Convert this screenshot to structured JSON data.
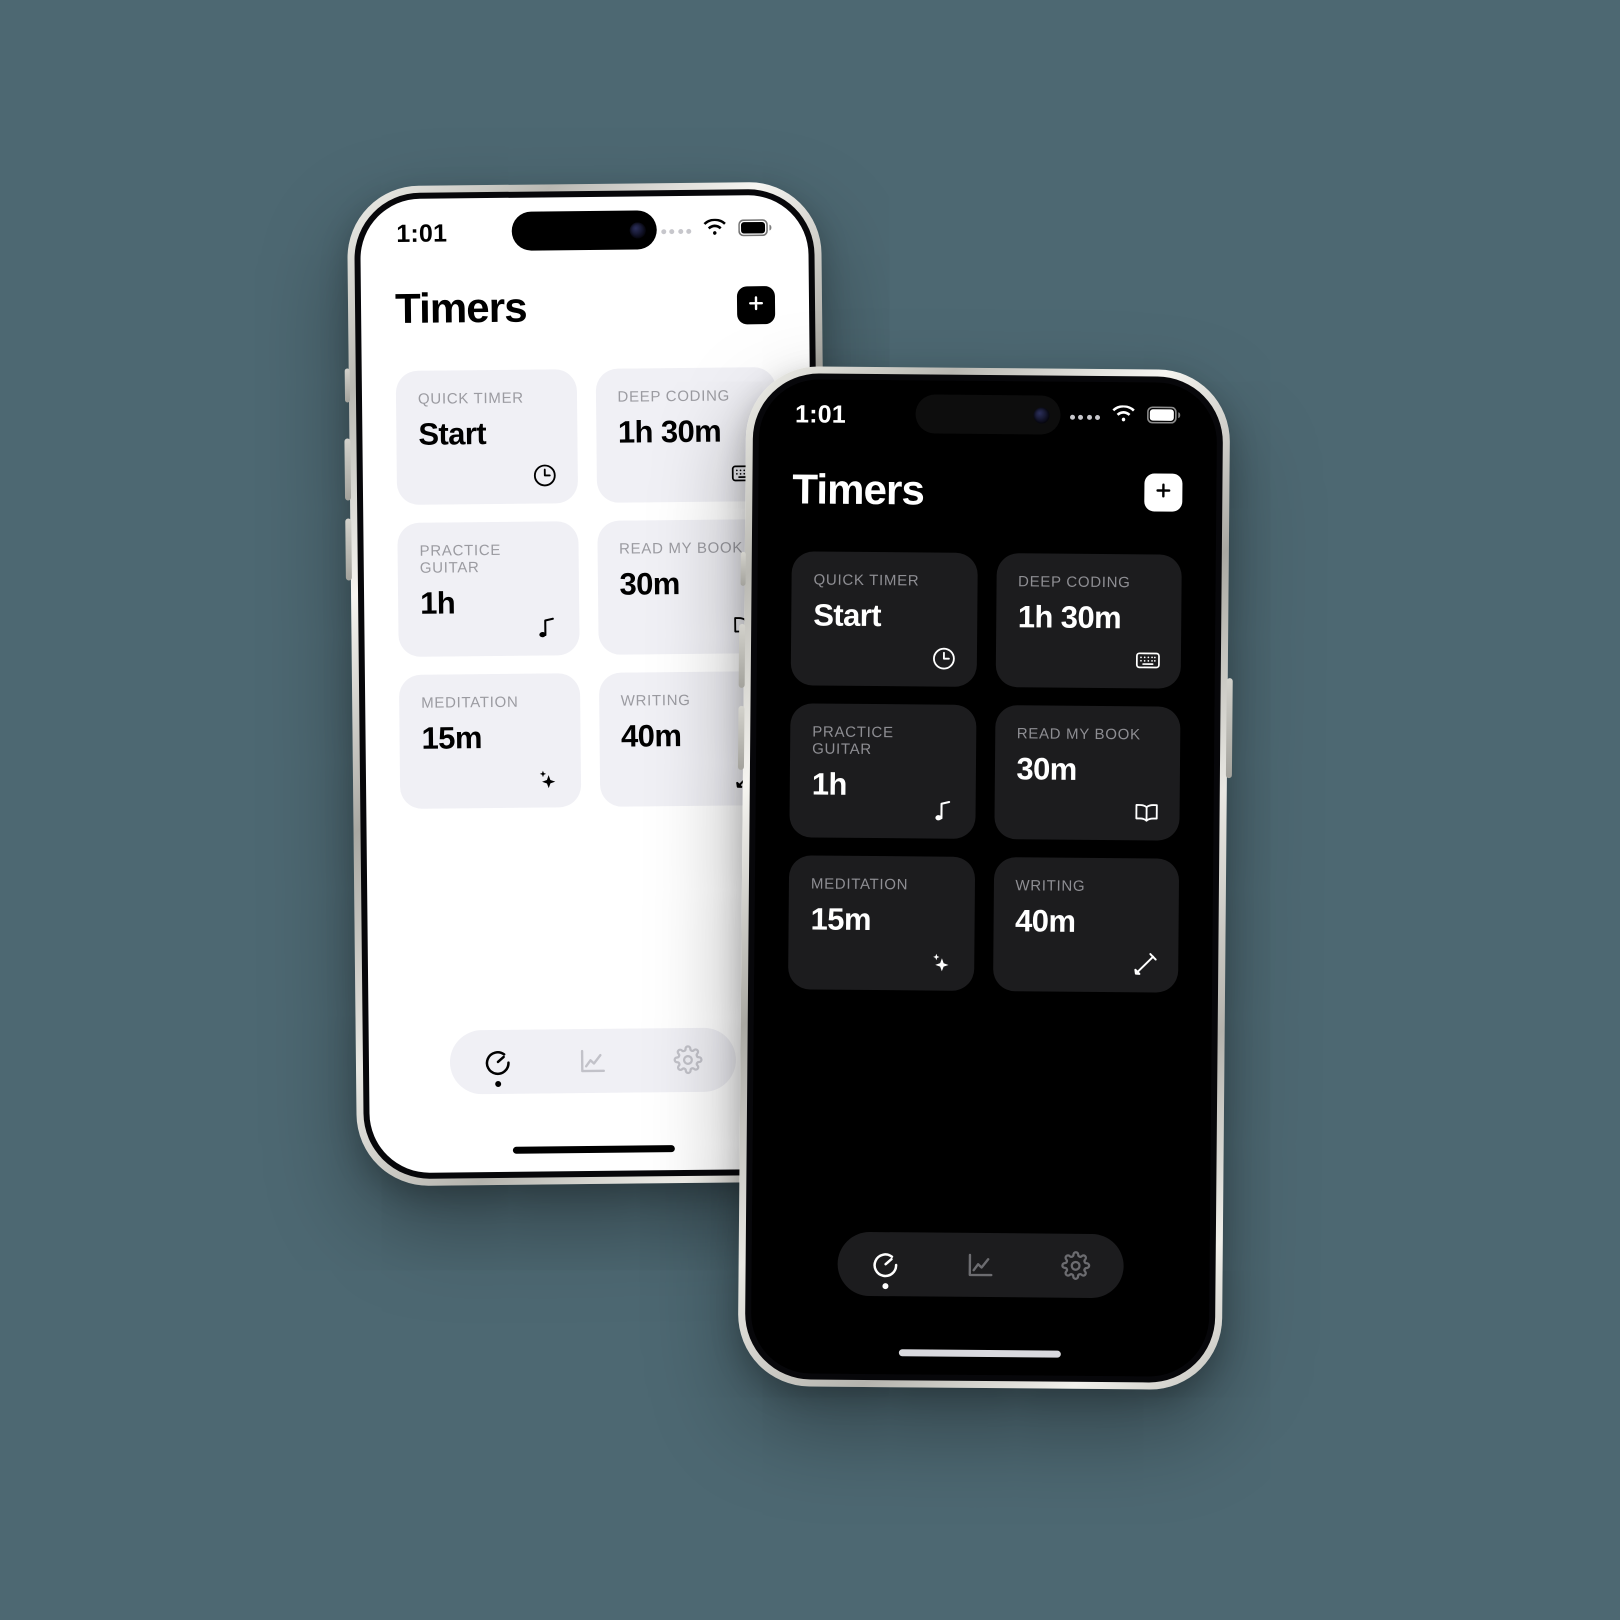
{
  "background_color": "#4d6872",
  "phones": [
    {
      "id": "light",
      "appearance": "Light",
      "status": {
        "time": "1:01",
        "cellular_icon": "cellular-dots-icon",
        "wifi_icon": "wifi-icon",
        "battery_icon": "battery-icon"
      },
      "header": {
        "title": "Timers",
        "add_label": "+",
        "add_icon": "plus-icon"
      },
      "cards": [
        {
          "label": "QUICK TIMER",
          "value": "Start",
          "icon": "clock-icon"
        },
        {
          "label": "DEEP CODING",
          "value": "1h 30m",
          "icon": "keyboard-icon"
        },
        {
          "label": "PRACTICE GUITAR",
          "value": "1h",
          "icon": "music-note-icon"
        },
        {
          "label": "READ MY BOOK",
          "value": "30m",
          "icon": "book-icon"
        },
        {
          "label": "MEDITATION",
          "value": "15m",
          "icon": "sparkles-icon"
        },
        {
          "label": "WRITING",
          "value": "40m",
          "icon": "pencil-icon"
        }
      ],
      "tabs": [
        {
          "name": "timers",
          "icon": "timer-icon",
          "active": true
        },
        {
          "name": "stats",
          "icon": "chart-line-icon",
          "active": false
        },
        {
          "name": "settings",
          "icon": "gear-icon",
          "active": false
        }
      ]
    },
    {
      "id": "dark",
      "appearance": "Dark",
      "status": {
        "time": "1:01",
        "cellular_icon": "cellular-dots-icon",
        "wifi_icon": "wifi-icon",
        "battery_icon": "battery-icon"
      },
      "header": {
        "title": "Timers",
        "add_label": "+",
        "add_icon": "plus-icon"
      },
      "cards": [
        {
          "label": "QUICK TIMER",
          "value": "Start",
          "icon": "clock-icon"
        },
        {
          "label": "DEEP CODING",
          "value": "1h 30m",
          "icon": "keyboard-icon"
        },
        {
          "label": "PRACTICE GUITAR",
          "value": "1h",
          "icon": "music-note-icon"
        },
        {
          "label": "READ MY BOOK",
          "value": "30m",
          "icon": "book-icon"
        },
        {
          "label": "MEDITATION",
          "value": "15m",
          "icon": "sparkles-icon"
        },
        {
          "label": "WRITING",
          "value": "40m",
          "icon": "pencil-icon"
        }
      ],
      "tabs": [
        {
          "name": "timers",
          "icon": "timer-icon",
          "active": true
        },
        {
          "name": "stats",
          "icon": "chart-line-icon",
          "active": false
        },
        {
          "name": "settings",
          "icon": "gear-icon",
          "active": false
        }
      ]
    }
  ]
}
